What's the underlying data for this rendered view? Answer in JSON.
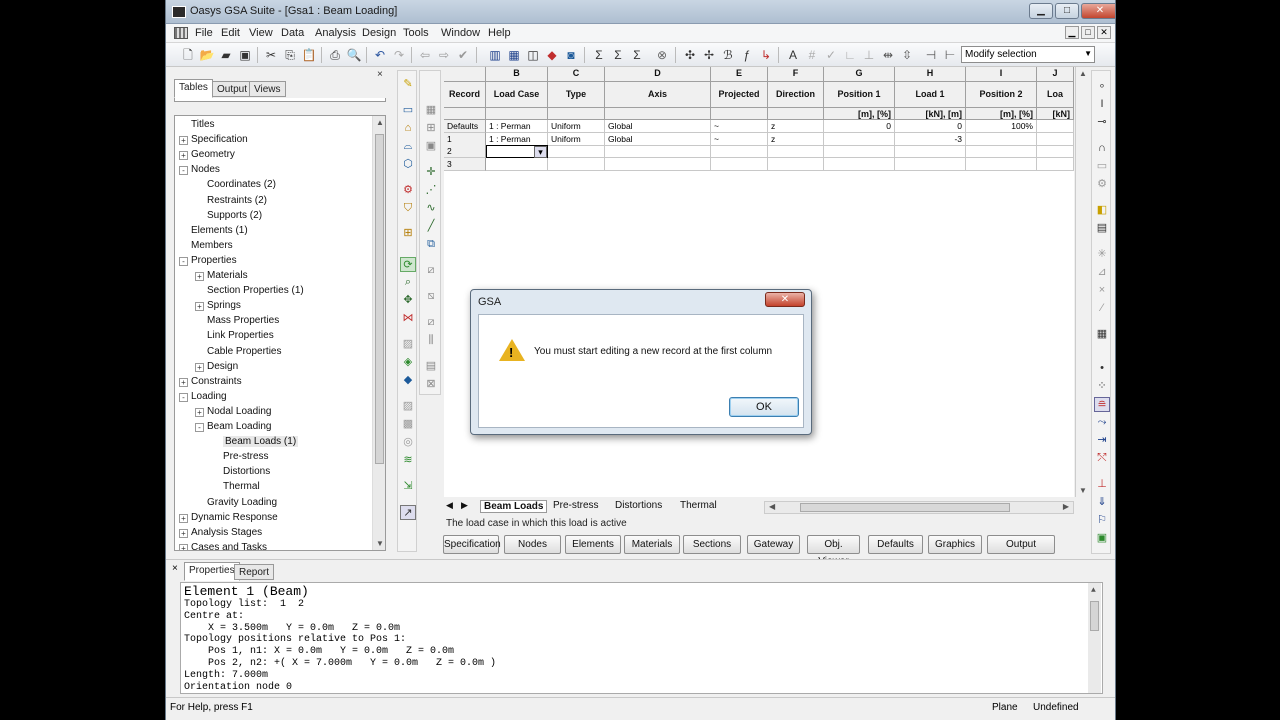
{
  "window": {
    "title": "Oasys GSA Suite - [Gsa1 : Beam Loading]",
    "min_glyph": "▁",
    "max_glyph": "□",
    "close_glyph": "✕"
  },
  "menu": [
    "File",
    "Edit",
    "View",
    "Data",
    "Analysis",
    "Design",
    "Tools",
    "Window",
    "Help"
  ],
  "toolbar": {
    "mode_select": "Modify selection"
  },
  "left_panel": {
    "close": "×",
    "tabs": [
      "Tables",
      "Output",
      "Views"
    ],
    "tree": [
      {
        "label": "Titles",
        "level": 0,
        "toggle": ""
      },
      {
        "label": "Specification",
        "level": 0,
        "toggle": "+"
      },
      {
        "label": "Geometry",
        "level": 0,
        "toggle": "+"
      },
      {
        "label": "Nodes",
        "level": 0,
        "toggle": "-"
      },
      {
        "label": "Coordinates (2)",
        "level": 1,
        "toggle": ""
      },
      {
        "label": "Restraints (2)",
        "level": 1,
        "toggle": ""
      },
      {
        "label": "Supports (2)",
        "level": 1,
        "toggle": ""
      },
      {
        "label": "Elements (1)",
        "level": 0,
        "toggle": ""
      },
      {
        "label": "Members",
        "level": 0,
        "toggle": ""
      },
      {
        "label": "Properties",
        "level": 0,
        "toggle": "-"
      },
      {
        "label": "Materials",
        "level": 1,
        "toggle": "+"
      },
      {
        "label": "Section Properties (1)",
        "level": 1,
        "toggle": ""
      },
      {
        "label": "Springs",
        "level": 1,
        "toggle": "+"
      },
      {
        "label": "Mass Properties",
        "level": 1,
        "toggle": ""
      },
      {
        "label": "Link Properties",
        "level": 1,
        "toggle": ""
      },
      {
        "label": "Cable Properties",
        "level": 1,
        "toggle": ""
      },
      {
        "label": "Design",
        "level": 1,
        "toggle": "+"
      },
      {
        "label": "Constraints",
        "level": 0,
        "toggle": "+"
      },
      {
        "label": "Loading",
        "level": 0,
        "toggle": "-"
      },
      {
        "label": "Nodal Loading",
        "level": 1,
        "toggle": "+"
      },
      {
        "label": "Beam Loading",
        "level": 1,
        "toggle": "-"
      },
      {
        "label": "Beam Loads (1)",
        "level": 2,
        "toggle": ""
      },
      {
        "label": "Pre-stress",
        "level": 2,
        "toggle": ""
      },
      {
        "label": "Distortions",
        "level": 2,
        "toggle": ""
      },
      {
        "label": "Thermal",
        "level": 2,
        "toggle": ""
      },
      {
        "label": "Gravity Loading",
        "level": 1,
        "toggle": ""
      },
      {
        "label": "Dynamic Response",
        "level": 0,
        "toggle": "+"
      },
      {
        "label": "Analysis Stages",
        "level": 0,
        "toggle": "+"
      },
      {
        "label": "Cases and Tasks",
        "level": 0,
        "toggle": "+"
      }
    ]
  },
  "table": {
    "letters": [
      "B",
      "C",
      "D",
      "E",
      "F",
      "G",
      "H",
      "I",
      "J"
    ],
    "headers": [
      "Record",
      "Load Case",
      "Type",
      "Axis",
      "Projected",
      "Direction",
      "Position 1",
      "Load 1",
      "Position 2",
      "Loa"
    ],
    "units": [
      "",
      "",
      "",
      "",
      "",
      "",
      "[m], [%]",
      "[kN], [m]",
      "[m], [%]",
      "[kN]"
    ],
    "rows": [
      [
        "Defaults",
        "1 : Perman",
        "Uniform",
        "Global",
        "~",
        "z",
        "0",
        "0",
        "100%",
        ""
      ],
      [
        "1",
        "1 : Perman",
        "Uniform",
        "Global",
        "~",
        "z",
        "",
        "-3",
        "",
        ""
      ],
      [
        "2",
        "",
        "",
        "",
        "",
        "",
        "",
        "",
        "",
        ""
      ],
      [
        "3",
        "",
        "",
        "",
        "",
        "",
        "",
        "",
        "",
        ""
      ]
    ]
  },
  "sheet_tabs": [
    "Beam Loads",
    "Pre-stress",
    "Distortions",
    "Thermal"
  ],
  "hint": "The load case in which this load is active",
  "bottom_buttons": [
    "Specification",
    "Nodes",
    "Elements",
    "Materials",
    "Sections",
    "Gateway",
    "Obj. Viewer",
    "Defaults",
    "Graphics",
    "Output"
  ],
  "properties": {
    "tabs": [
      "Properties",
      "Report"
    ],
    "close": "×",
    "lines": [
      "Element 1 (Beam)",
      "Topology list:  1  2",
      "Centre at:",
      "    X = 3.500m   Y = 0.0m   Z = 0.0m",
      "Topology positions relative to Pos 1:",
      "    Pos 1, n1: X = 0.0m   Y = 0.0m   Z = 0.0m",
      "    Pos 2, n2: +( X = 7.000m   Y = 0.0m   Z = 0.0m )",
      "Length: 7.000m",
      "Orientation node 0"
    ]
  },
  "status": {
    "help": "For Help, press F1",
    "plane": "Plane",
    "undefined": "Undefined"
  },
  "dialog": {
    "title": "GSA",
    "close": "✕",
    "message": "You must start editing a new record at the first column",
    "ok": "OK",
    "warning_glyph": "!"
  }
}
